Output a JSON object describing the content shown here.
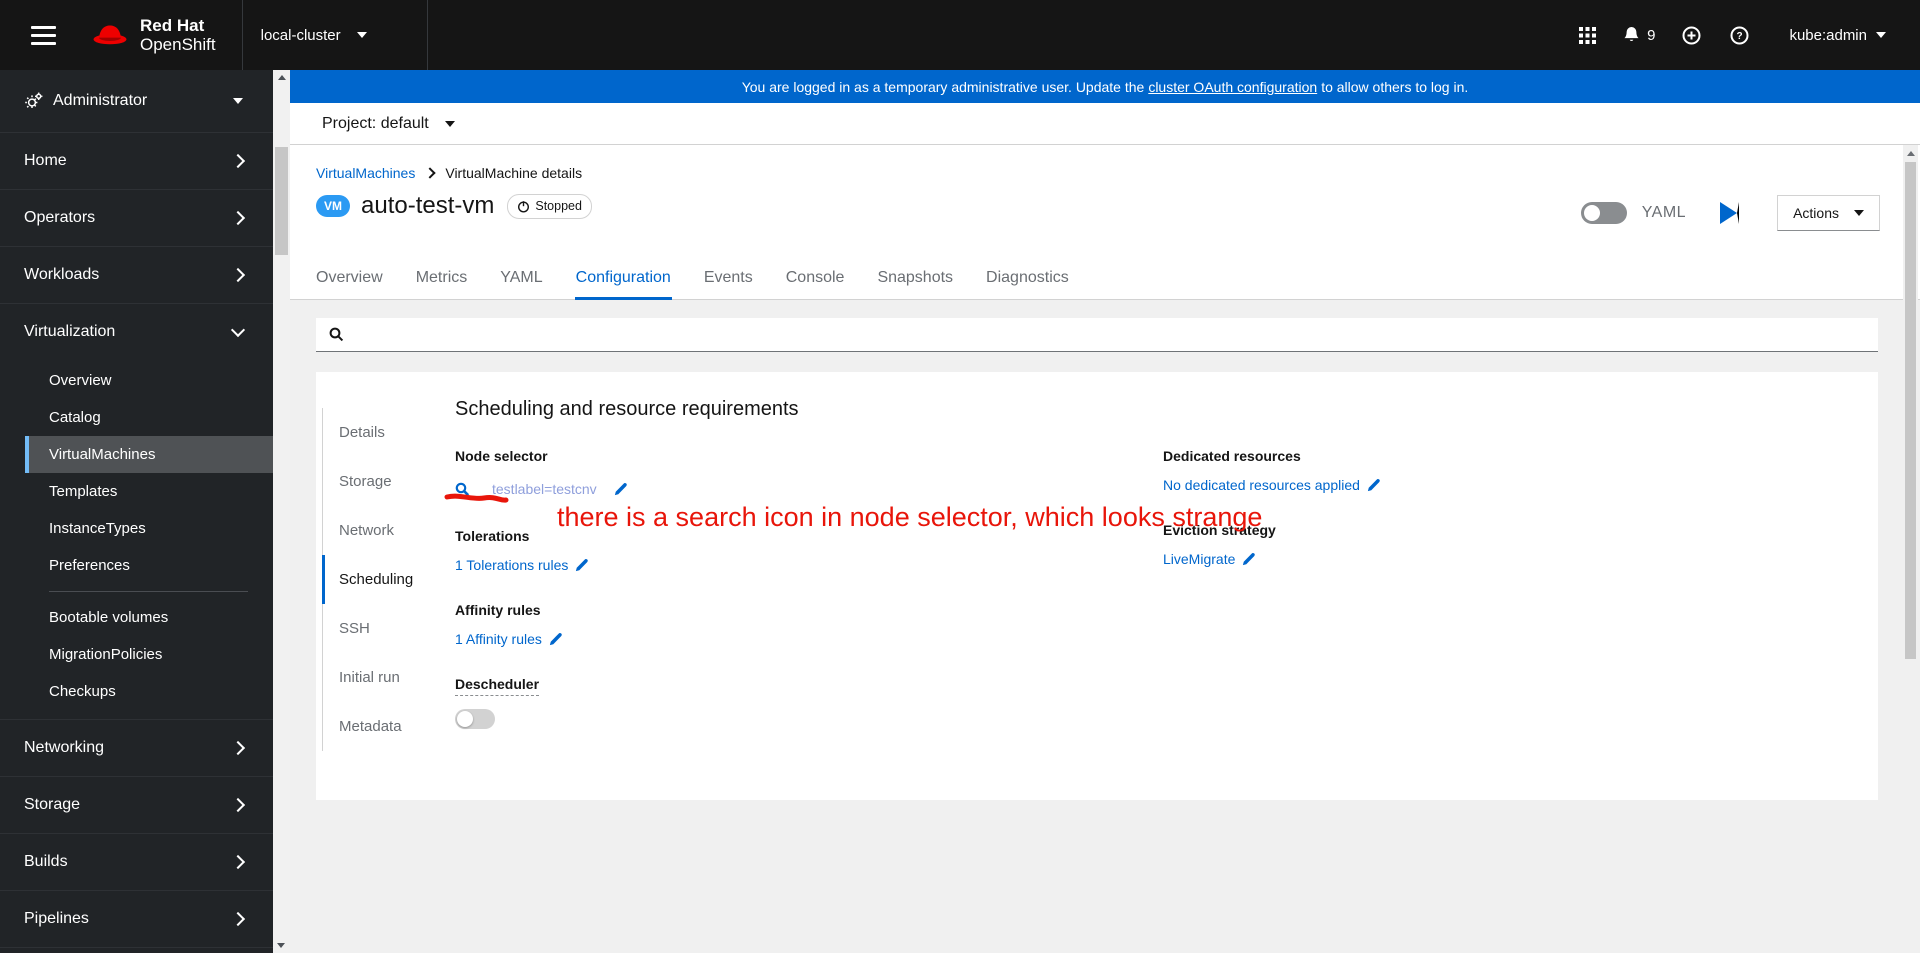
{
  "colors": {
    "accent_blue": "#0066cc",
    "banner_blue": "#0066cc",
    "vm_badge_blue": "#2b9af3",
    "nav_active_indicator": "#73bcf7",
    "annotation_red": "#e8150a",
    "node_selector_value_color": "#8f9fdc"
  },
  "header": {
    "brand_top": "Red Hat",
    "brand_bottom": "OpenShift",
    "cluster": "local-cluster",
    "notification_count": "9",
    "user": "kube:admin"
  },
  "banner": {
    "text_before": "You are logged in as a temporary administrative user. Update the",
    "link_text": "cluster OAuth configuration",
    "text_after": "to allow others to log in."
  },
  "project_bar": {
    "label": "Project:",
    "value": "default"
  },
  "sidebar": {
    "perspective": "Administrator",
    "items": [
      {
        "label": "Home"
      },
      {
        "label": "Operators"
      },
      {
        "label": "Workloads"
      },
      {
        "label": "Virtualization"
      },
      {
        "label": "Networking"
      },
      {
        "label": "Storage"
      },
      {
        "label": "Builds"
      },
      {
        "label": "Pipelines"
      }
    ],
    "virtualization_items": [
      {
        "label": "Overview"
      },
      {
        "label": "Catalog"
      },
      {
        "label": "VirtualMachines",
        "active": true
      },
      {
        "label": "Templates"
      },
      {
        "label": "InstanceTypes"
      },
      {
        "label": "Preferences"
      },
      {
        "label": "Bootable volumes"
      },
      {
        "label": "MigrationPolicies"
      },
      {
        "label": "Checkups"
      }
    ]
  },
  "page": {
    "breadcrumb": [
      {
        "label": "VirtualMachines"
      },
      {
        "label": "VirtualMachine details"
      }
    ],
    "vm_badge": "VM",
    "title": "auto-test-vm",
    "status": "Stopped",
    "yaml_label": "YAML",
    "actions_label": "Actions",
    "tabs": [
      {
        "label": "Overview"
      },
      {
        "label": "Metrics"
      },
      {
        "label": "YAML"
      },
      {
        "label": "Configuration",
        "active": true
      },
      {
        "label": "Events"
      },
      {
        "label": "Console"
      },
      {
        "label": "Snapshots"
      },
      {
        "label": "Diagnostics"
      }
    ]
  },
  "configuration": {
    "subnav": [
      {
        "label": "Details"
      },
      {
        "label": "Storage"
      },
      {
        "label": "Network"
      },
      {
        "label": "Scheduling",
        "active": true
      },
      {
        "label": "SSH"
      },
      {
        "label": "Initial run"
      },
      {
        "label": "Metadata"
      }
    ],
    "heading": "Scheduling and resource requirements",
    "node_selector": {
      "label": "Node selector",
      "value": "testlabel=testcnv"
    },
    "tolerations": {
      "label": "Tolerations",
      "value": "1 Tolerations rules"
    },
    "affinity": {
      "label": "Affinity rules",
      "value": "1 Affinity rules"
    },
    "descheduler": {
      "label": "Descheduler"
    },
    "dedicated_resources": {
      "label": "Dedicated resources",
      "value": "No dedicated resources applied"
    },
    "eviction_strategy": {
      "label": "Eviction strategy",
      "value": "LiveMigrate"
    }
  },
  "annotation": {
    "text": "there is a search icon in node selector, which looks strange"
  }
}
